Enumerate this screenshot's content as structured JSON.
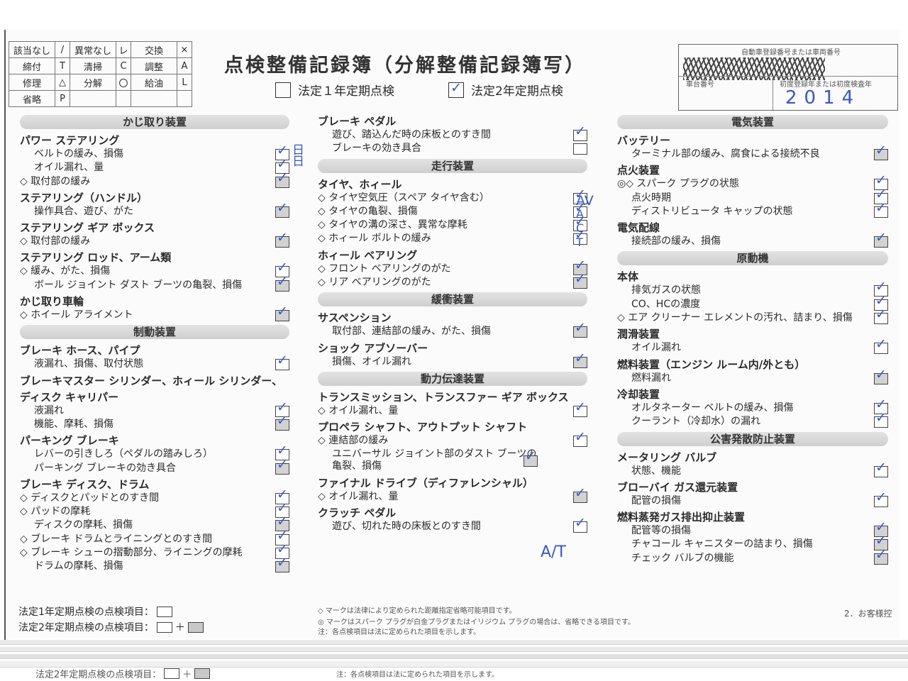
{
  "legend": [
    [
      "該当なし",
      "/",
      "異常なし",
      "レ",
      "交換",
      "×"
    ],
    [
      "締付",
      "T",
      "清掃",
      "C",
      "調整",
      "A"
    ],
    [
      "修理",
      "△",
      "分解",
      "〇",
      "給油",
      "L"
    ],
    [
      "省略",
      "P",
      "",
      "",
      "",
      ""
    ]
  ],
  "title": "点検整備記録簿（分解整備記録簿写）",
  "checks": {
    "annual1": "法定１年定期点検",
    "annual2": "法定2年定期点検",
    "annual2_mark": "✓"
  },
  "registration": {
    "label_top": "自動車登録番号または車両番号",
    "label_chassis": "車台番号",
    "label_year": "初度登録年または初度検査年",
    "year": "2014"
  },
  "tick": "✓",
  "columns": [
    [
      {
        "bar": "かじ取り装置"
      },
      {
        "hdr": "パワー ステアリング"
      },
      {
        "item": "ベルトの緩み、損傷",
        "box": "plain",
        "tick": true
      },
      {
        "item": "オイル漏れ、量",
        "box": "plain",
        "tick": true
      },
      {
        "item": "◇ 取付部の緩み",
        "dia": true,
        "box": "gray",
        "tick": true
      },
      {
        "hdr": "ステアリング（ハンドル）"
      },
      {
        "item": "操作具合、遊び、がた",
        "box": "gray",
        "tick": true
      },
      {
        "hdr": "ステアリング ギア ボックス"
      },
      {
        "item": "◇ 取付部の緩み",
        "dia": true,
        "box": "gray",
        "tick": true
      },
      {
        "hdr": "ステアリング ロッド、アーム類"
      },
      {
        "item": "◇ 緩み、がた、損傷",
        "dia": true,
        "box": "plain",
        "tick": true
      },
      {
        "item": "ボール ジョイント ダスト ブーツの亀裂、損傷",
        "box": "gray",
        "tick": true
      },
      {
        "hdr": "かじ取り車輪"
      },
      {
        "item": "◇ ホイール アライメント",
        "dia": true,
        "box": "gray",
        "tick": true
      },
      {
        "bar": "制動装置"
      },
      {
        "hdr": "ブレーキ ホース、パイプ"
      },
      {
        "item": "液漏れ、損傷、取付状態",
        "box": "plain",
        "tick": true
      },
      {
        "hdr": "ブレーキマスター シリンダー、ホィール シリンダー、"
      },
      {
        "hdr": "ディスク キャリパー"
      },
      {
        "item": "液漏れ",
        "box": "plain",
        "tick": true
      },
      {
        "item": "機能、摩耗、損傷",
        "box": "gray",
        "tick": true
      },
      {
        "hdr": "パーキング ブレーキ"
      },
      {
        "item": "レバーの引きしろ（ペダルの踏みしろ）",
        "box": "plain",
        "tick": true
      },
      {
        "item": "パーキング ブレーキの効き具合",
        "box": "gray",
        "tick": true
      },
      {
        "hdr": "ブレーキ ディスク、ドラム"
      },
      {
        "item": "◇ ディスクとパッドとのすき間",
        "dia": true,
        "box": "plain",
        "tick": true
      },
      {
        "item": "◇ パッドの摩耗",
        "dia": true,
        "box": "plain",
        "tick": true
      },
      {
        "item": "ディスクの摩耗、損傷",
        "box": "gray",
        "tick": true
      },
      {
        "item": "◇ ブレーキ ドラムとライニングとのすき間",
        "dia": true,
        "box": "plain",
        "tick": true
      },
      {
        "item": "◇ ブレーキ シューの摺動部分、ライニングの摩耗",
        "dia": true,
        "box": "plain",
        "tick": true
      },
      {
        "item": "ドラムの摩耗、損傷",
        "box": "gray",
        "tick": true
      }
    ],
    [
      {
        "hdr": "ブレーキ ペダル"
      },
      {
        "item": "遊び、踏込んだ時の床板とのすき間",
        "box": "plain",
        "tick": true
      },
      {
        "item": "ブレーキの効き具合",
        "box": "plain",
        "tick": false
      },
      {
        "bar": "走行装置"
      },
      {
        "hdr": "タイヤ、ホィール"
      },
      {
        "item": "◇ タイヤ空気圧（スペア タイヤ含む）",
        "dia": true,
        "box": "plain",
        "tick": true
      },
      {
        "item": "◇ タイヤの亀裂、損傷",
        "dia": true,
        "box": "plain",
        "tick": true
      },
      {
        "item": "◇ タイヤの溝の深さ、異常な摩耗",
        "dia": true,
        "box": "plain",
        "tick": true
      },
      {
        "item": "◇ ホィール ボルトの緩み",
        "dia": true,
        "box": "plain",
        "tick": true
      },
      {
        "hdr": "ホィール ベアリング"
      },
      {
        "item": "◇ フロント ベアリングのがた",
        "dia": true,
        "box": "gray",
        "tick": true
      },
      {
        "item": "◇ リア ベアリングのがた",
        "dia": true,
        "box": "gray",
        "tick": true
      },
      {
        "bar": "緩衝装置"
      },
      {
        "hdr": "サスペンション"
      },
      {
        "item": "取付部、連結部の緩み、がた、損傷",
        "box": "gray",
        "tick": true
      },
      {
        "hdr": "ショック アブソーバー"
      },
      {
        "item": "損傷、オイル漏れ",
        "box": "gray",
        "tick": true
      },
      {
        "bar": "動力伝達装置"
      },
      {
        "hdr": "トランスミッション、トランスファー ギア ボックス"
      },
      {
        "item": "◇ オイル漏れ、量",
        "dia": true,
        "box": "plain",
        "tick": true
      },
      {
        "hdr": "プロペラ シャフト、アウトプット シャフト"
      },
      {
        "item": "◇ 連結部の緩み",
        "dia": true,
        "box": "plain",
        "tick": true
      },
      {
        "item": "ユニバーサル ジョイント部のダスト ブーツの亀裂、損傷",
        "box": "gray",
        "tick": true,
        "wrap": true
      },
      {
        "hdr": "ファイナル ドライブ（ディファレンシャル）"
      },
      {
        "item": "◇ オイル漏れ、量",
        "dia": true,
        "box": "gray",
        "tick": true
      },
      {
        "hdr": "クラッチ ペダル"
      },
      {
        "item": "遊び、切れた時の床板とのすき間",
        "box": "plain",
        "tick": true
      }
    ],
    [
      {
        "bar": "電気装置"
      },
      {
        "hdr": "バッテリー"
      },
      {
        "item": "ターミナル部の緩み、腐食による接続不良",
        "box": "gray",
        "tick": true
      },
      {
        "hdr": "点火装置"
      },
      {
        "item": "◎◇ スパーク プラグの状態",
        "dia": true,
        "box": "plain",
        "tick": true
      },
      {
        "item": "点火時期",
        "box": "plain",
        "tick": true
      },
      {
        "item": "ディストリビュータ キャップの状態",
        "box": "plain",
        "tick": true
      },
      {
        "hdr": "電気配線"
      },
      {
        "item": "接続部の緩み、損傷",
        "box": "gray",
        "tick": true
      },
      {
        "bar": "原動機"
      },
      {
        "hdr": "本体"
      },
      {
        "item": "排気ガスの状態",
        "box": "plain",
        "tick": true
      },
      {
        "item": "CO、HCの濃度",
        "box": "plain",
        "tick": true
      },
      {
        "item": "◇ エア クリーナー エレメントの汚れ、詰まり、損傷",
        "dia": true,
        "box": "plain",
        "tick": true
      },
      {
        "hdr": "潤滑装置"
      },
      {
        "item": "オイル漏れ",
        "box": "plain",
        "tick": true
      },
      {
        "hdr": "燃料装置（エンジン ルーム内/外とも）"
      },
      {
        "item": "燃料漏れ",
        "box": "gray",
        "tick": true
      },
      {
        "hdr": "冷却装置"
      },
      {
        "item": "オルタネーター ベルトの緩み、損傷",
        "box": "plain",
        "tick": true
      },
      {
        "item": "クーラント（冷却水）の漏れ",
        "box": "plain",
        "tick": true
      },
      {
        "bar": "公害発散防止装置"
      },
      {
        "hdr": "メータリング バルブ"
      },
      {
        "item": "状態、機能",
        "box": "plain",
        "tick": true
      },
      {
        "hdr": "ブローバイ ガス還元装置"
      },
      {
        "item": "配管の損傷",
        "box": "plain",
        "tick": true
      },
      {
        "hdr": "燃料蒸発ガス排出抑止装置"
      },
      {
        "item": "配管等の損傷",
        "box": "gray",
        "tick": true
      },
      {
        "item": "チャコール キャニスターの詰まり、損傷",
        "box": "gray",
        "tick": true
      },
      {
        "item": "チェック バルブの機能",
        "box": "gray",
        "tick": true
      }
    ]
  ],
  "annotations": {
    "col1_mark": "日日",
    "tire_marks": [
      "AV",
      "A",
      "C",
      "T"
    ],
    "clutch_mark": "A/T"
  },
  "footer": {
    "line1": "法定1年定期点検の点検項目：",
    "line2": "法定2年定期点検の点検項目：",
    "plus": "＋",
    "note1": "◇ マークは法律により定められた距離指定省略可能項目です。",
    "note2": "◎ マークはスパーク プラグが白金プラグまたはイリジウム プラグの場合は、省略できる項目です。",
    "note3": "注：各点検項目は法に定められた項目を示します。",
    "copy": "2．お客様控",
    "ghost_line": "法定2年定期点検の点検項目：",
    "ghost_note": "注：各点検項目は法に定められた項目を示します。"
  },
  "colors": {
    "ink": "#3a57c7",
    "bar": "#d4d4d4"
  }
}
